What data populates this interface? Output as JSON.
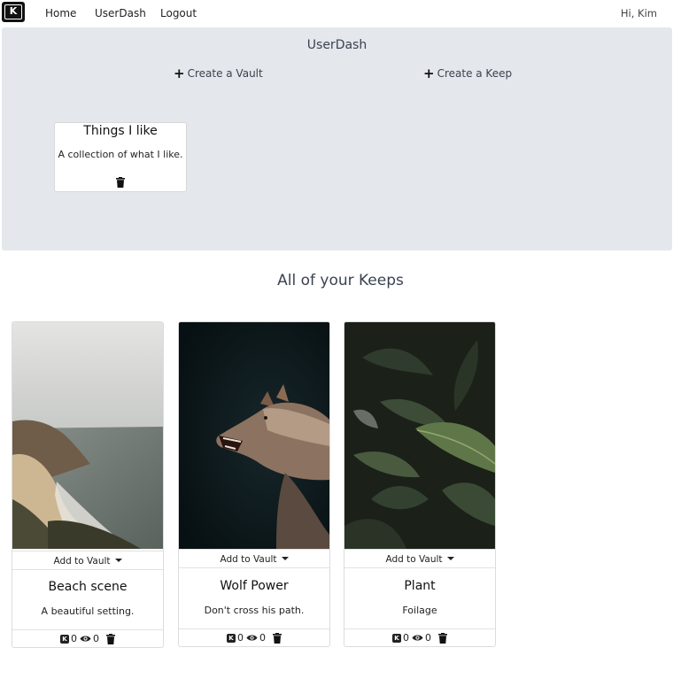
{
  "nav": {
    "logo_letter": "K",
    "links": [
      {
        "label": "Home"
      },
      {
        "label": "UserDash"
      },
      {
        "label": "Logout"
      }
    ],
    "greeting": "Hi, Kim"
  },
  "dashboard": {
    "title": "UserDash",
    "create_vault_label": "Create a Vault",
    "create_keep_label": "Create a Keep",
    "vaults": [
      {
        "name": "Things I like",
        "description": "A collection of what I like.",
        "icon": "trash-icon"
      }
    ]
  },
  "keeps_section": {
    "title": "All of your Keeps",
    "keeps": [
      {
        "name": "Beach scene",
        "description": "A beautiful setting.",
        "add_to_vault_label": "Add to Vault",
        "keeps_count": "0",
        "views_count": "0",
        "image": "beach-photo"
      },
      {
        "name": "Wolf Power",
        "description": "Don't cross his path.",
        "add_to_vault_label": "Add to Vault",
        "keeps_count": "0",
        "views_count": "0",
        "image": "wolf-photo"
      },
      {
        "name": "Plant",
        "description": "Foilage",
        "add_to_vault_label": "Add to Vault",
        "keeps_count": "0",
        "views_count": "0",
        "image": "plant-photo"
      }
    ]
  },
  "icons": {
    "plus": "plus-icon",
    "trash": "trash-icon",
    "keep": "keep-icon",
    "eye": "eye-icon",
    "caret": "caret-down-icon"
  }
}
